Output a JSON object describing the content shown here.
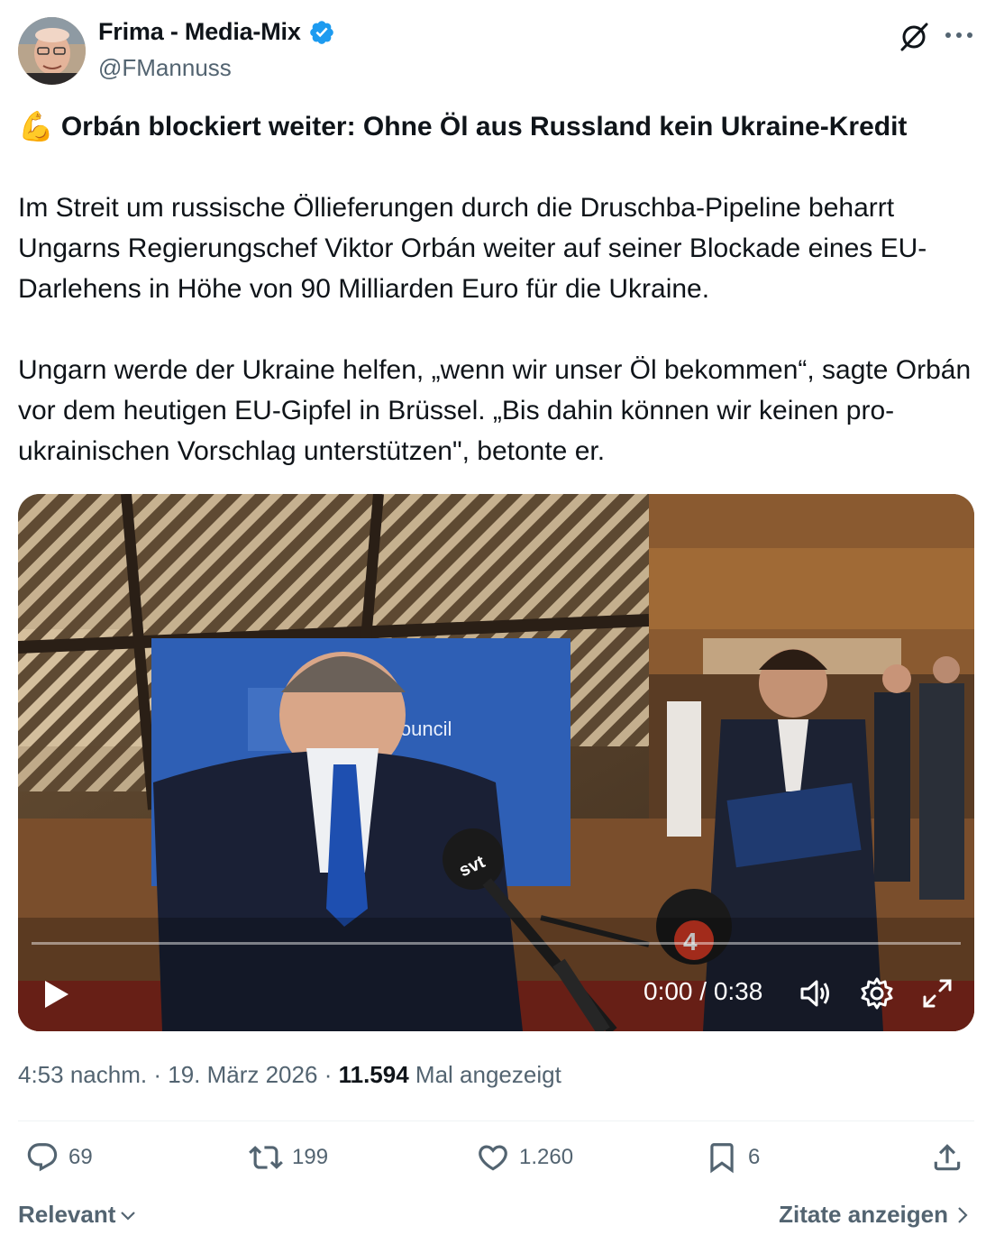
{
  "author": {
    "display_name": "Frima - Media-Mix",
    "handle": "@FMannuss",
    "verified_color": "#1d9bf0"
  },
  "icons": {
    "grok": "grok-icon",
    "more": "more-icon",
    "headline_emoji": "💪"
  },
  "tweet": {
    "headline": "Orbán blockiert weiter: Ohne Öl aus Russland kein Ukraine-Kredit",
    "paragraph_1": "Im Streit um russische Öllieferungen durch die Druschba-Pipeline beharrt Ungarns Regierungschef Viktor Orbán weiter auf seiner Blockade eines EU-Darlehens in Höhe von 90 Milliarden Euro für die Ukraine.",
    "paragraph_2": "Ungarn werde der Ukraine helfen, „wenn wir unser Öl bekommen“, sagte Orbán vor dem heutigen EU-Gipfel in Brüssel. „Bis dahin können wir keinen pro-ukrainischen Vorschlag unterstützen\", betonte er."
  },
  "video": {
    "time_display": "0:00 / 0:38",
    "backdrop_text": "Council",
    "mic_label_svt": "svt",
    "mic_label_4": "4",
    "progress_fraction": 0
  },
  "meta": {
    "time": "4:53 nachm.",
    "separator": "·",
    "date": "19. März 2026",
    "views_count": "11.594",
    "views_label": "Mal angezeigt"
  },
  "actions": {
    "replies": "69",
    "reposts": "199",
    "likes": "1.260",
    "bookmarks": "6"
  },
  "footer": {
    "sort_label": "Relevant",
    "quotes_label": "Zitate anzeigen"
  }
}
